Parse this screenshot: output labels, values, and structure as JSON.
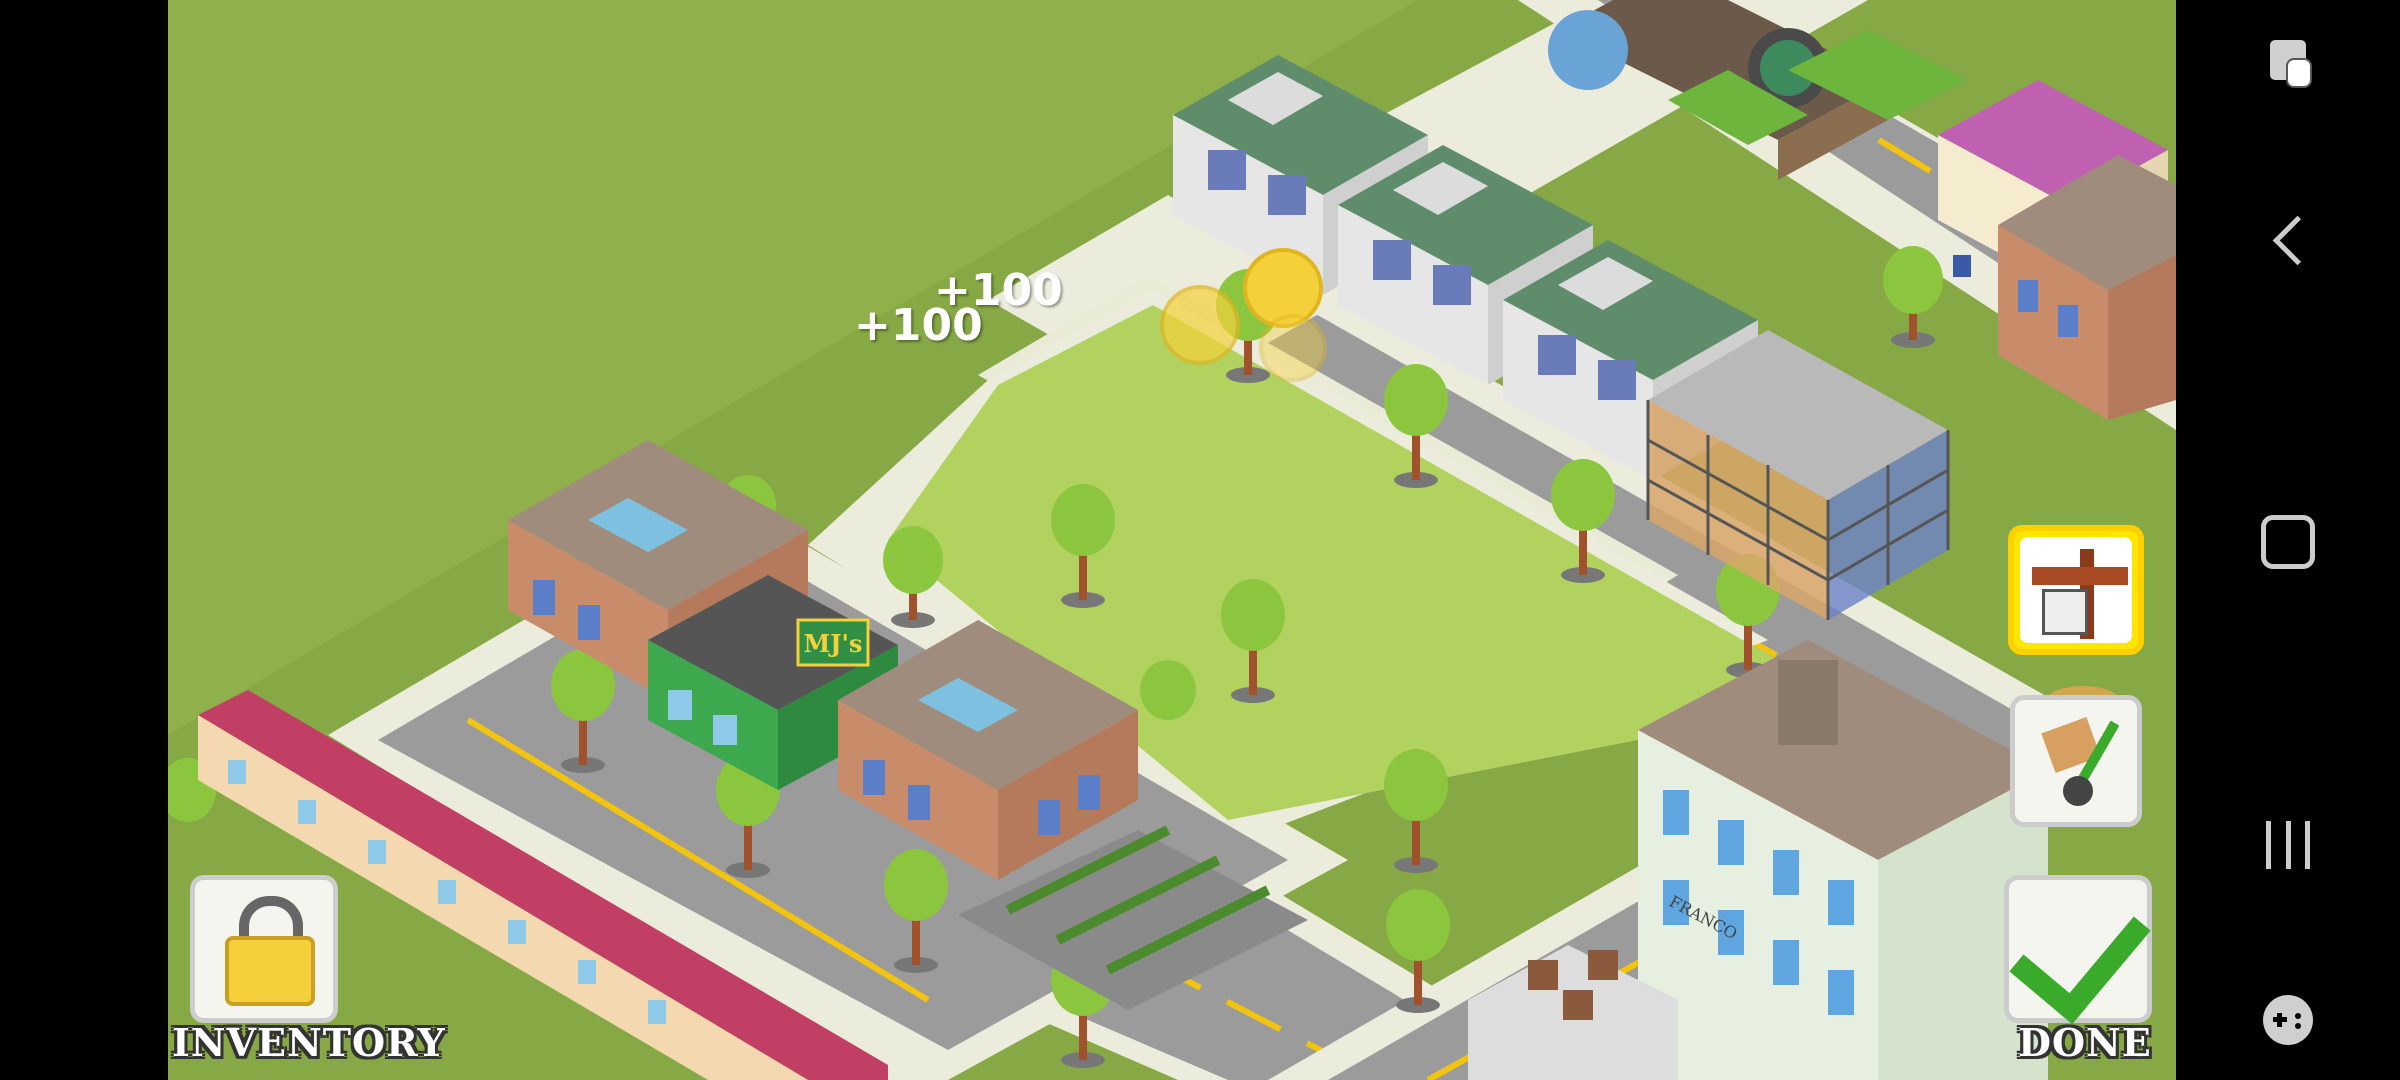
{
  "hud": {
    "inventory_label": "INVENTORY",
    "done_label": "DONE",
    "floating_rewards": [
      "+100",
      "+100"
    ]
  },
  "signs": {
    "shop_sign": "MJ's",
    "warehouse_sign": "FRANCO"
  },
  "colors": {
    "grass": "#8fb04a",
    "empty_lot": "#b2d260",
    "road": "#9b9b9b",
    "sidewalk": "#ececdc",
    "road_line": "#f2c40f",
    "done_check": "#3aaa2a",
    "lock_gold": "#f4d13a",
    "highlight_frame": "#ffe600"
  },
  "icons": {
    "inventory": "padlock-icon",
    "done": "checkmark-icon",
    "build": "signpost-icon",
    "move": "hand-truck-icon",
    "nav_top": "screen-tap-icon",
    "nav_back": "back-chevron-icon",
    "nav_home": "home-square-icon",
    "nav_recents": "recents-lines-icon",
    "nav_game": "gamepad-icon"
  }
}
